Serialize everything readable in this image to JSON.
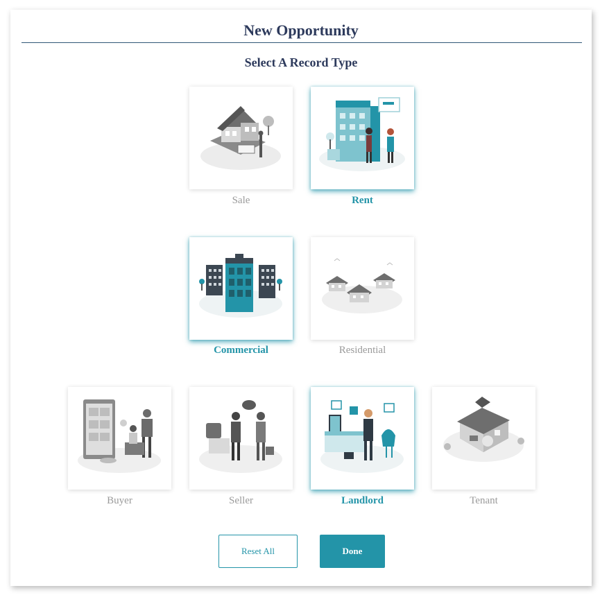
{
  "modal": {
    "title": "New Opportunity",
    "subtitle": "Select A Record Type"
  },
  "accent_color": "#2394a8",
  "record_types": [
    {
      "label": "Sale",
      "selected": false,
      "illustration": "house-for-sale-icon"
    },
    {
      "label": "Rent",
      "selected": true,
      "illustration": "apartment-rent-icon"
    },
    {
      "label": "Commercial",
      "selected": true,
      "illustration": "office-buildings-icon"
    },
    {
      "label": "Residential",
      "selected": false,
      "illustration": "houses-neighborhood-icon"
    },
    {
      "label": "Buyer",
      "selected": false,
      "illustration": "buyer-browsing-icon"
    },
    {
      "label": "Seller",
      "selected": false,
      "illustration": "seller-deal-icon"
    },
    {
      "label": "Landlord",
      "selected": true,
      "illustration": "landlord-office-icon"
    },
    {
      "label": "Tenant",
      "selected": false,
      "illustration": "tenant-home-icon"
    }
  ],
  "buttons": {
    "reset_label": "Reset All",
    "done_label": "Done"
  }
}
